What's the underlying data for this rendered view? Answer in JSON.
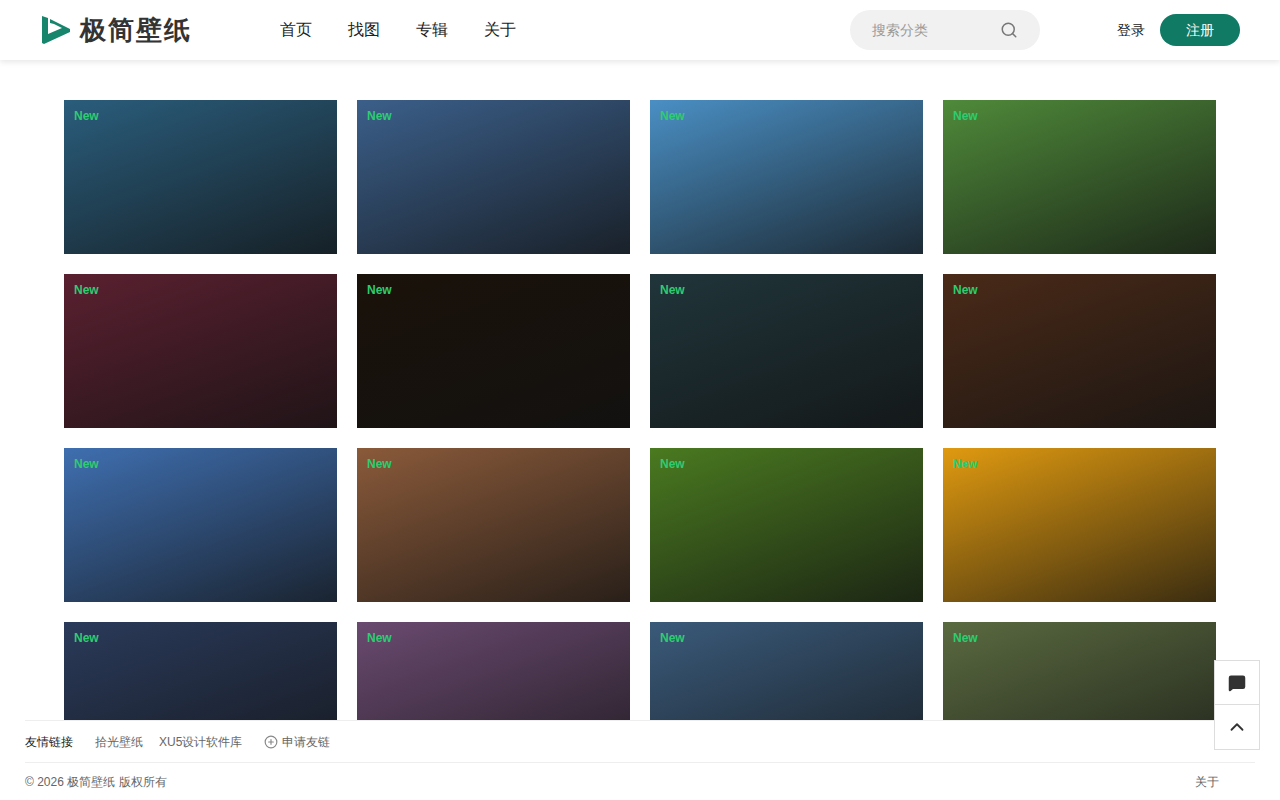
{
  "header": {
    "logo": "极简壁纸",
    "nav": [
      {
        "label": "首页",
        "selected": false
      },
      {
        "label": "找图",
        "selected": false
      },
      {
        "label": "专辑",
        "selected": false
      },
      {
        "label": "关于",
        "selected": false
      }
    ],
    "search": {
      "placeholder": "搜索分类"
    },
    "login": "登录",
    "register": "注册"
  },
  "wallpapers": [
    {
      "badge": "New",
      "color": "#2a5d7c"
    },
    {
      "badge": "New",
      "color": "#3b5f8a"
    },
    {
      "badge": "New",
      "color": "#4a8fc4"
    },
    {
      "badge": "New",
      "color": "#4f8a3a"
    },
    {
      "badge": "New",
      "color": "#5a2030"
    },
    {
      "badge": "New",
      "color": "#1a120a"
    },
    {
      "badge": "New",
      "color": "#20353a"
    },
    {
      "badge": "New",
      "color": "#4a2a18"
    },
    {
      "badge": "New",
      "color": "#3f6fb0"
    },
    {
      "badge": "New",
      "color": "#8a5a3a"
    },
    {
      "badge": "New",
      "color": "#4a7a20"
    },
    {
      "badge": "New",
      "color": "#e09a10"
    },
    {
      "badge": "New",
      "color": "#2a3a5a"
    },
    {
      "badge": "New",
      "color": "#6a4a70"
    },
    {
      "badge": "New",
      "color": "#3a5a7a"
    },
    {
      "badge": "New",
      "color": "#5a6a40"
    }
  ],
  "footer": {
    "links_title": "友情链接",
    "links": [
      "拾光壁纸",
      "XU5设计软件库"
    ],
    "apply": "申请友链",
    "copyright": "© 2026 极简壁纸 版权所有",
    "about": "关于"
  }
}
